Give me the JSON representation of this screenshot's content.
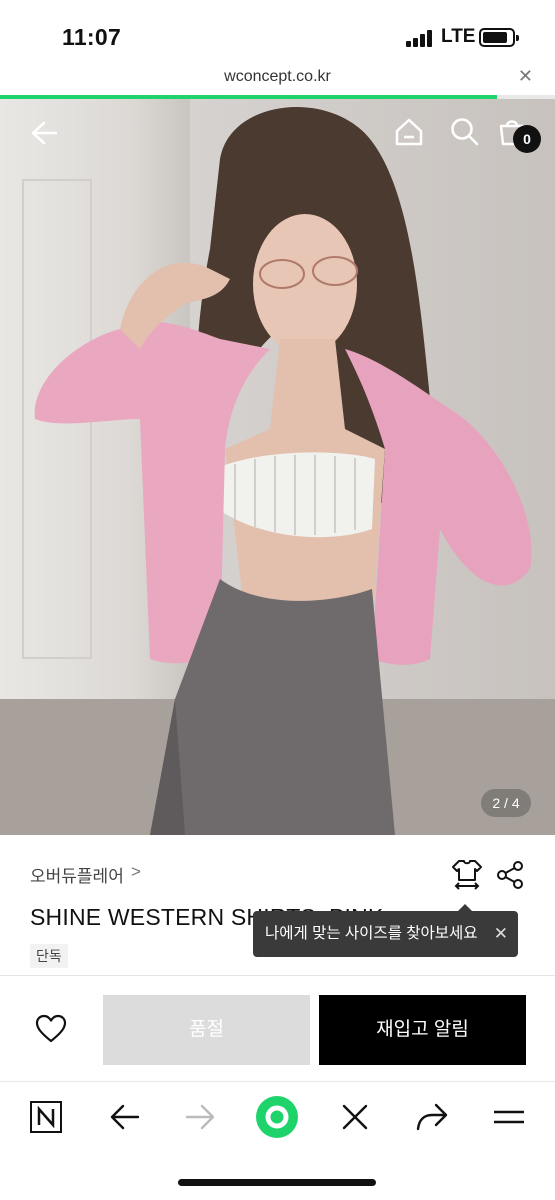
{
  "status_bar": {
    "time": "11:07",
    "network": "LTE",
    "battery_icon": "battery-icon",
    "signal_icon": "signal-icon"
  },
  "url_bar": {
    "url": "wconcept.co.kr",
    "close_icon": "close-icon",
    "load_progress": 0.895,
    "progress_color": "#1fd36b"
  },
  "hero": {
    "image_counter": "2 / 4",
    "icons": [
      "back-arrow-icon",
      "home-icon",
      "search-icon",
      "cart-icon"
    ],
    "cart_count": "0"
  },
  "product": {
    "brand": "오버듀플레어",
    "brand_chevron": ">",
    "title": "SHINE WESTERN SHIRTS_PINK",
    "badge": "단독",
    "icons": [
      "size-guide-icon",
      "share-icon"
    ]
  },
  "tooltip": {
    "text": "나에게 맞는 사이즈를 찾아보세요",
    "close": "✕"
  },
  "actions": {
    "wish_icon": "heart-icon",
    "soldout_label": "품절",
    "restock_label": "재입고 알림"
  },
  "browser_toolbar": {
    "items": [
      "naver-icon",
      "back-icon",
      "forward-icon",
      "green-dot-icon",
      "close-icon",
      "share-icon",
      "menu-icon"
    ],
    "accent": "#1fd36b"
  }
}
